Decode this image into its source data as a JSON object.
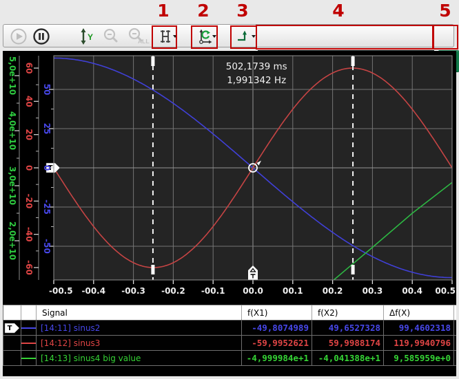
{
  "callouts": {
    "labels": [
      "1",
      "2",
      "3",
      "4",
      "5"
    ],
    "color": "#c00000"
  },
  "toolbar": {
    "zoom_all_text": "ALL",
    "y_axis_letter": "Y",
    "buttons": [
      "play",
      "pause",
      "color-scheme",
      "autoscale-y",
      "zoom-out",
      "zoom-out-all",
      "cursor-tool",
      "axis-tool",
      "signal-step-tool",
      "x-range-slider",
      "panel-toggle"
    ]
  },
  "markers": {
    "trigger_letter": "T"
  },
  "chart_data": {
    "type": "line",
    "background": "#242424",
    "x_axis": {
      "unit": "s",
      "range": [
        -0.5,
        0.5
      ],
      "tick_values": [
        -0.5,
        -0.4,
        -0.3,
        -0.2,
        -0.1,
        0,
        0.1,
        0.2,
        0.3,
        0.4,
        0.5
      ],
      "tick_labels": [
        "-00.5",
        "-00.4",
        "-00.3",
        "-00.2",
        "-00.1",
        "00.0",
        "00.1",
        "00.2",
        "00.3",
        "00.4",
        "00.5"
      ]
    },
    "y_axes": [
      {
        "id": "green",
        "color": "#2ecc40",
        "min": 12875000000,
        "max": 53625000000,
        "tick_values": [
          50000000000,
          40000000000,
          30000000000,
          20000000000
        ],
        "tick_labels": [
          "5,0e+10",
          "4,0e+10",
          "3,0e+10",
          "2,0e+10"
        ]
      },
      {
        "id": "red",
        "color": "#e04545",
        "min": -67.45,
        "max": 67.45,
        "tick_values": [
          60,
          40,
          20,
          0,
          -20,
          -40,
          -60
        ],
        "tick_labels": [
          "60",
          "40",
          "20",
          "0",
          "-20",
          "-40",
          "-60"
        ]
      },
      {
        "id": "blue",
        "color": "#4747e8",
        "min": -71.5,
        "max": 71.5,
        "tick_values": [
          50,
          25,
          0,
          -25,
          -50
        ],
        "tick_labels": [
          "50",
          "25",
          "0",
          "-25",
          "-50"
        ]
      }
    ],
    "grid_y_axis": "blue",
    "series": [
      {
        "name": "sinus2",
        "channel": "[14:11] sinus2",
        "color": "#4040d8",
        "axis": "blue",
        "model": "sine",
        "amplitude": 70,
        "frequency_hz": 0.5,
        "phase_deg": 180
      },
      {
        "name": "sinus3",
        "channel": "[14:12] sinus3",
        "color": "#c64444",
        "axis": "red",
        "model": "sine",
        "amplitude": 60,
        "frequency_hz": 1,
        "phase_deg": 0
      },
      {
        "name": "sinus4",
        "channel": "[14:13] sinus4 big value",
        "color": "#2db843",
        "axis": "green",
        "model": "points",
        "points": [
          [
            0.203,
            12875000000
          ],
          [
            0.3,
            18800000000
          ],
          [
            0.4,
            25000000000
          ],
          [
            0.5,
            30600000000
          ]
        ]
      }
    ],
    "cursors": {
      "x1": -0.251,
      "x2": 0.251,
      "annotation_x": 0.009
    },
    "annotation": {
      "line1": "502,1739 ms",
      "line2": "1,991342 Hz"
    }
  },
  "table": {
    "headers": {
      "signal": "Signal",
      "fx1": "f(X1)",
      "fx2": "f(X2)",
      "dfx": "Δf(X)"
    },
    "rows": [
      {
        "marker": true,
        "color": "#4747e8",
        "signal": "[14:11] sinus2",
        "fx1": "-49,8074989",
        "fx2": "49,6527328",
        "dfx": "99,4602318"
      },
      {
        "marker": false,
        "color": "#e04545",
        "signal": "[14:12] sinus3",
        "fx1": "-59,9952621",
        "fx2": "59,9988174",
        "dfx": "119,9940796"
      },
      {
        "marker": false,
        "color": "#35d435",
        "signal": "[14:13] sinus4 big value",
        "fx1": "-4,999984e+1",
        "fx2": "-4,041388e+1",
        "dfx": "9,585959e+0"
      }
    ]
  }
}
